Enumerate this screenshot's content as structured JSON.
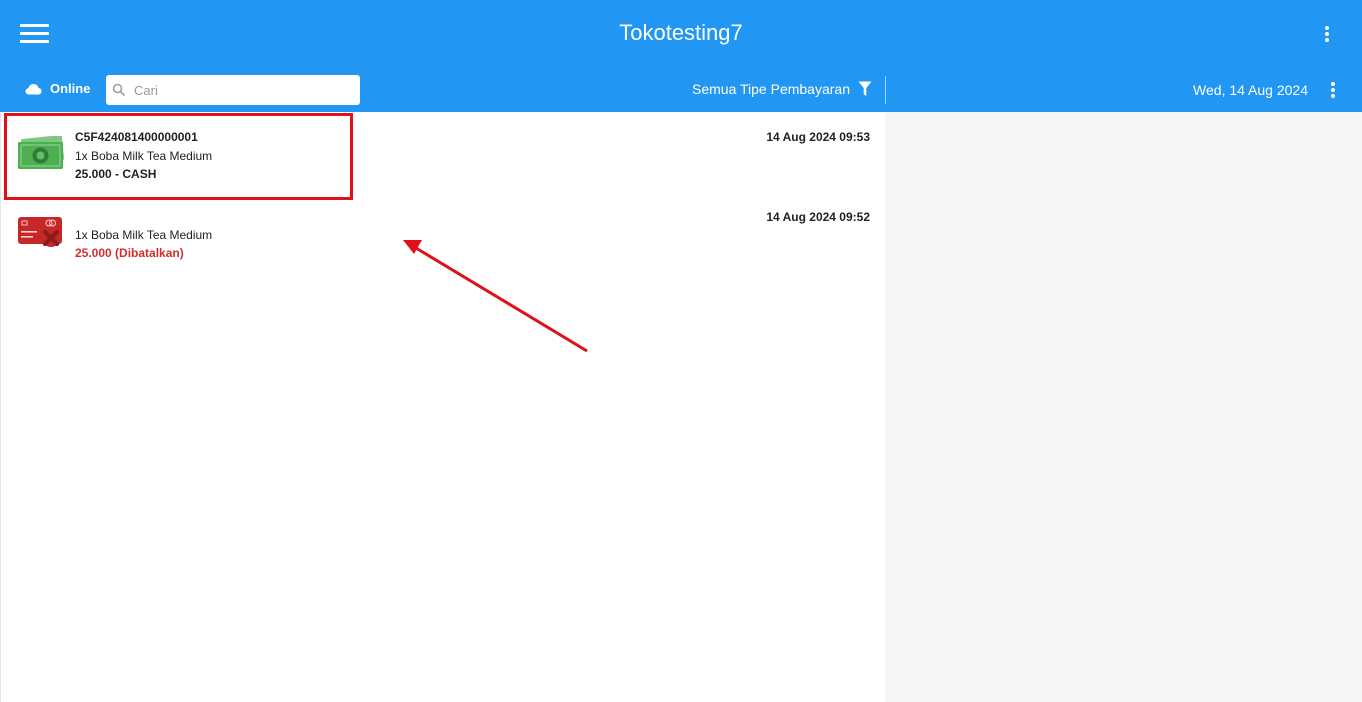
{
  "appbar": {
    "title": "Tokotesting7",
    "status": "Online",
    "search_placeholder": "Cari",
    "payment_filter": "Semua Tipe Pembayaran",
    "date": "Wed, 14 Aug 2024"
  },
  "transactions": [
    {
      "id": "C5F424081400000001",
      "item": "1x Boba Milk Tea Medium",
      "total": "25.000 - CASH",
      "time": "14 Aug 2024 09:53",
      "icon": "cash-icon",
      "cancelled": false
    },
    {
      "id": "",
      "item": "1x Boba Milk Tea Medium",
      "total": "25.000 (Dibatalkan)",
      "time": "14 Aug 2024 09:52",
      "icon": "cancelled-card-icon",
      "cancelled": true
    }
  ],
  "colors": {
    "primary": "#2196F3",
    "cancelled": "#d32f2f",
    "highlight": "#e0101a",
    "detail_bg": "#f6f6f6"
  }
}
